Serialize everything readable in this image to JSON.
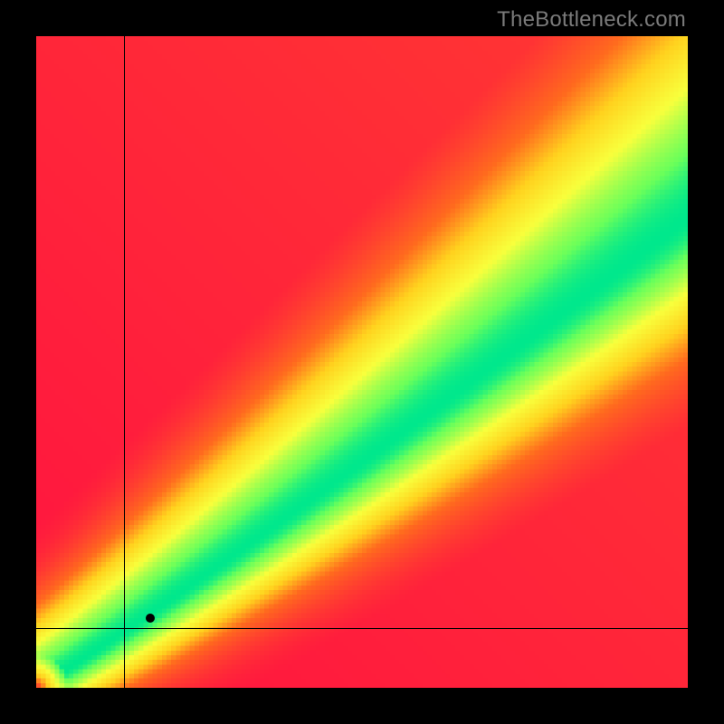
{
  "watermark": "TheBottleneck.com",
  "chart_data": {
    "type": "heatmap",
    "title": "",
    "xlabel": "",
    "ylabel": "",
    "xlim": [
      0,
      1
    ],
    "ylim": [
      0,
      1
    ],
    "grid": false,
    "legend": null,
    "colorscale": {
      "description": "red -> orange -> yellow -> green (diagonal band optimal)",
      "stops": [
        {
          "t": 0.0,
          "hex": "#ff1440"
        },
        {
          "t": 0.35,
          "hex": "#ff6a1e"
        },
        {
          "t": 0.55,
          "hex": "#ffd21e"
        },
        {
          "t": 0.75,
          "hex": "#f8ff3c"
        },
        {
          "t": 0.93,
          "hex": "#6aff5a"
        },
        {
          "t": 1.0,
          "hex": "#00e88c"
        }
      ]
    },
    "field": {
      "description": "goodness = 1 on the optimal curve y ≈ slope*x, falling off with distance; damped near origin",
      "slope": 0.72,
      "band_halfwidth": 0.055,
      "pixelation": 140
    },
    "crosshair": {
      "x": 0.135,
      "y": 0.092
    },
    "marker": {
      "x": 0.175,
      "y": 0.107
    }
  }
}
